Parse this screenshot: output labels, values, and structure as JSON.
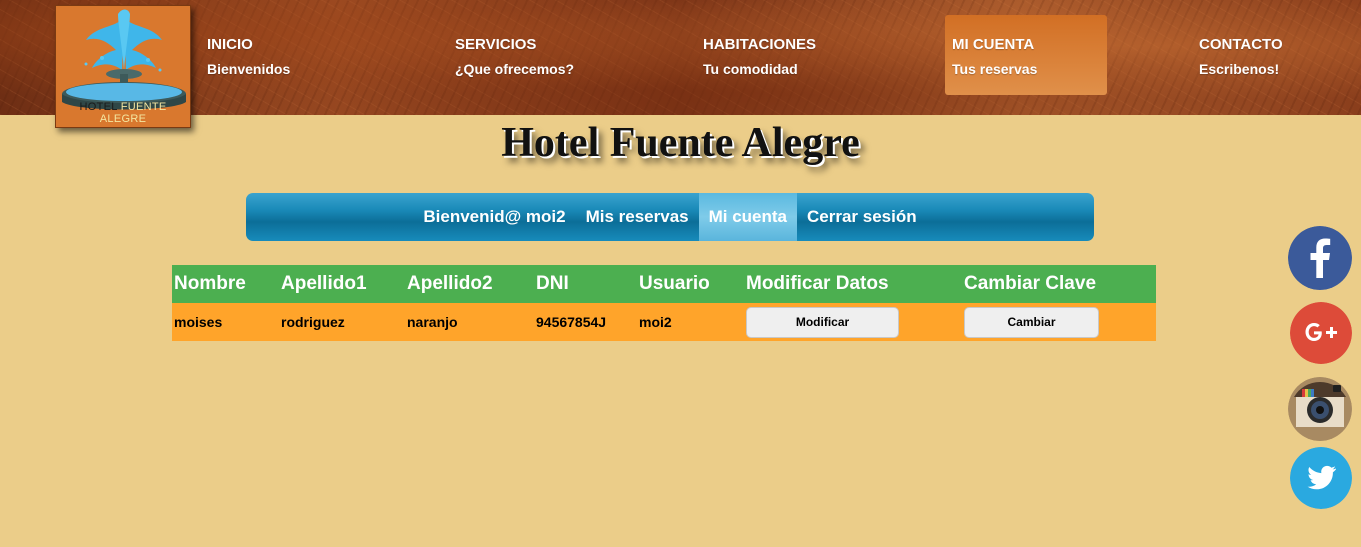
{
  "logo": {
    "text_main": "HOTEL",
    "text_highlight": "FUENTE ALEGRE"
  },
  "nav": [
    {
      "title": "INICIO",
      "subtitle": "Bienvenidos"
    },
    {
      "title": "SERVICIOS",
      "subtitle": "¿Que ofrecemos?"
    },
    {
      "title": "HABITACIONES",
      "subtitle": "Tu comodidad"
    },
    {
      "title": "MI CUENTA",
      "subtitle": "Tus reservas"
    },
    {
      "title": "CONTACTO",
      "subtitle": "Escribenos!"
    }
  ],
  "site_title": "Hotel Fuente Alegre",
  "user_menu": {
    "welcome": "Bienvenid@ moi2",
    "reservas": "Mis reservas",
    "cuenta": "Mi cuenta",
    "logout": "Cerrar sesión"
  },
  "table": {
    "headers": [
      "Nombre",
      "Apellido1",
      "Apellido2",
      "DNI",
      "Usuario",
      "Modificar Datos",
      "Cambiar Clave"
    ],
    "row": {
      "nombre": "moises",
      "apellido1": "rodriguez",
      "apellido2": "naranjo",
      "dni": "94567854J",
      "usuario": "moi2",
      "modificar_label": "Modificar",
      "cambiar_label": "Cambiar"
    }
  },
  "social": [
    "facebook-icon",
    "google-plus-icon",
    "instagram-icon",
    "twitter-icon"
  ],
  "colors": {
    "background": "#ebcd89",
    "nav_active": "#d97a30",
    "menu_blue": "#1a8ab8",
    "table_header": "#4caf50",
    "table_row": "#ffa42a"
  }
}
